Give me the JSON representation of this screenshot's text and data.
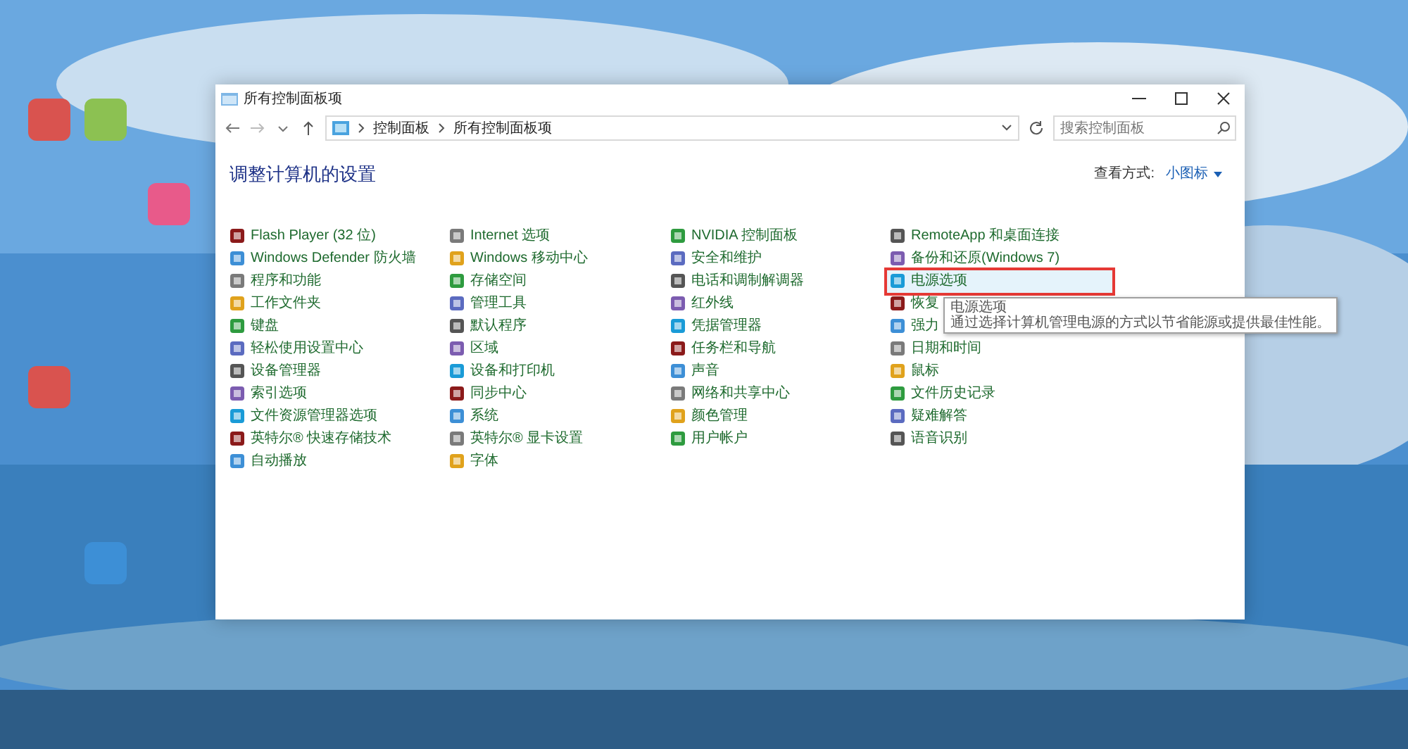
{
  "window": {
    "title": "所有控制面板项"
  },
  "address_bar": {
    "crumbs": [
      "控制面板",
      "所有控制面板项"
    ]
  },
  "search": {
    "placeholder": "搜索控制面板"
  },
  "heading": "调整计算机的设置",
  "view": {
    "label": "查看方式:",
    "value": "小图标"
  },
  "columns": [
    [
      {
        "label": "Flash Player (32 位)",
        "hovered": false
      },
      {
        "label": "Windows Defender 防火墙",
        "hovered": false
      },
      {
        "label": "程序和功能",
        "hovered": false
      },
      {
        "label": "工作文件夹",
        "hovered": false
      },
      {
        "label": "键盘",
        "hovered": false
      },
      {
        "label": "轻松使用设置中心",
        "hovered": false
      },
      {
        "label": "设备管理器",
        "hovered": false
      },
      {
        "label": "索引选项",
        "hovered": false
      },
      {
        "label": "文件资源管理器选项",
        "hovered": false
      },
      {
        "label": "英特尔® 快速存储技术",
        "hovered": false
      },
      {
        "label": "自动播放",
        "hovered": false
      }
    ],
    [
      {
        "label": "Internet 选项",
        "hovered": false
      },
      {
        "label": "Windows 移动中心",
        "hovered": false
      },
      {
        "label": "存储空间",
        "hovered": false
      },
      {
        "label": "管理工具",
        "hovered": false
      },
      {
        "label": "默认程序",
        "hovered": false
      },
      {
        "label": "区域",
        "hovered": false
      },
      {
        "label": "设备和打印机",
        "hovered": false
      },
      {
        "label": "同步中心",
        "hovered": false
      },
      {
        "label": "系统",
        "hovered": false
      },
      {
        "label": "英特尔® 显卡设置",
        "hovered": false
      },
      {
        "label": "字体",
        "hovered": false
      }
    ],
    [
      {
        "label": "NVIDIA 控制面板",
        "hovered": false
      },
      {
        "label": "安全和维护",
        "hovered": false
      },
      {
        "label": "电话和调制解调器",
        "hovered": false
      },
      {
        "label": "红外线",
        "hovered": false
      },
      {
        "label": "凭据管理器",
        "hovered": false
      },
      {
        "label": "任务栏和导航",
        "hovered": false
      },
      {
        "label": "声音",
        "hovered": false
      },
      {
        "label": "网络和共享中心",
        "hovered": false
      },
      {
        "label": "颜色管理",
        "hovered": false
      },
      {
        "label": "用户帐户",
        "hovered": false
      }
    ],
    [
      {
        "label": "RemoteApp 和桌面连接",
        "hovered": false
      },
      {
        "label": "备份和还原(Windows 7)",
        "hovered": false
      },
      {
        "label": "电源选项",
        "hovered": true
      },
      {
        "label": "恢复",
        "hovered": false
      },
      {
        "label": "强力",
        "hovered": false
      },
      {
        "label": "日期和时间",
        "hovered": false
      },
      {
        "label": "鼠标",
        "hovered": false
      },
      {
        "label": "文件历史记录",
        "hovered": false
      },
      {
        "label": "疑难解答",
        "hovered": false
      },
      {
        "label": "语音识别",
        "hovered": false
      }
    ]
  ],
  "tooltip": {
    "title": "电源选项",
    "text": "通过选择计算机管理电源的方式以节省能源或提供最佳性能。"
  }
}
